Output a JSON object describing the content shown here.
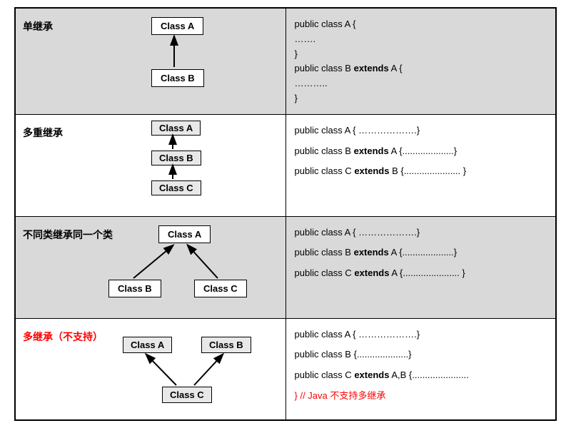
{
  "rows": [
    {
      "label": "单继承",
      "labelColor": "black",
      "classes": {
        "A": "Class A",
        "B": "Class B",
        "C": ""
      },
      "code": [
        {
          "t": "public class A {"
        },
        {
          "t": " ……."
        },
        {
          "t": "}"
        },
        {
          "t": "public class B <b>extends</b> A {"
        },
        {
          "t": " ……….."
        },
        {
          "t": "}"
        }
      ]
    },
    {
      "label": "多重继承",
      "labelColor": "black",
      "classes": {
        "A": "Class A",
        "B": "Class B",
        "C": "Class C"
      },
      "code": [
        {
          "t": "public class A { ……………….}"
        },
        {
          "t": ""
        },
        {
          "t": "public class B <b>extends</b> A {....................}"
        },
        {
          "t": ""
        },
        {
          "t": "public class C <b>extends</b>  B {...................... }"
        }
      ]
    },
    {
      "label": "不同类继承同一个类",
      "labelColor": "black",
      "classes": {
        "A": "Class A",
        "B": "Class B",
        "C": "Class C"
      },
      "code": [
        {
          "t": "public class A { ……………….}"
        },
        {
          "t": ""
        },
        {
          "t": "public class B <b>extends</b> A {....................}"
        },
        {
          "t": ""
        },
        {
          "t": "public class C <b>extends</b> A {...................... }"
        }
      ]
    },
    {
      "label": "多继承（不支持）",
      "labelColor": "red",
      "classes": {
        "A": "Class A",
        "B": "Class B",
        "C": "Class C"
      },
      "code": [
        {
          "t": "public class A { ……………….}"
        },
        {
          "t": ""
        },
        {
          "t": "public class B {....................}"
        },
        {
          "t": ""
        },
        {
          "t": "public class C <b>extends</b>  A,B {...................... "
        },
        {
          "t": ""
        },
        {
          "t": "<span class='red'>} // Java  不支持多继承</span>"
        }
      ]
    }
  ]
}
